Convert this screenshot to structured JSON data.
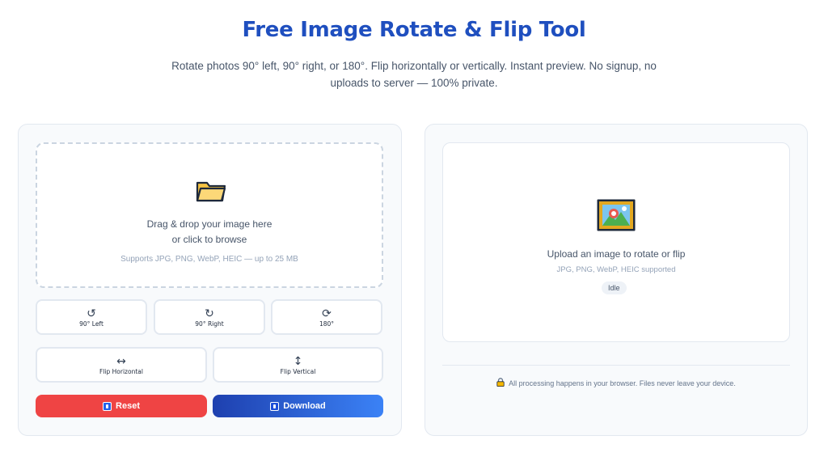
{
  "header": {
    "title": "Free Image Rotate & Flip Tool",
    "subtitle": "Rotate photos 90° left, 90° right, or 180°. Flip horizontally or vertically. Instant preview. No signup, no uploads to server — 100% private."
  },
  "upload": {
    "icon": "folder-icon",
    "line1": "Drag & drop your image here",
    "line2": "or click to browse",
    "hint": "Supports JPG, PNG, WebP, HEIC — up to 25 MB"
  },
  "controls": {
    "rotate_left": {
      "glyph": "↺",
      "label": "90° Left"
    },
    "rotate_right": {
      "glyph": "↻",
      "label": "90° Right"
    },
    "rotate_180": {
      "glyph": "⟳",
      "label": "180°"
    },
    "flip_horizontal": {
      "glyph": "↔",
      "label": "Flip Horizontal"
    },
    "flip_vertical": {
      "glyph": "↕",
      "label": "Flip Vertical"
    },
    "reset_label": "Reset",
    "download_label": "Download"
  },
  "preview": {
    "icon": "framed-picture-icon",
    "message": "Upload an image to rotate or flip",
    "formats": "JPG, PNG, WebP, HEIC supported",
    "status": "Idle"
  },
  "footer": {
    "icon": "lock-icon",
    "privacy_note": "All processing happens in your browser. Files never leave your device."
  },
  "colors": {
    "title": "#1f4fbf",
    "reset": "#ef4444",
    "download_start": "#1e40af",
    "download_end": "#3b82f6"
  }
}
